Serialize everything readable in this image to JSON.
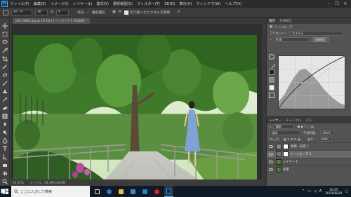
{
  "app": {
    "logo": "Ps"
  },
  "menu": [
    "ファイル(F)",
    "編集(E)",
    "イメージ(I)",
    "レイヤー(L)",
    "書式(Y)",
    "選択範囲(S)",
    "フィルター(T)",
    "3D(D)",
    "表示(V)",
    "ウィンドウ(W)",
    "ヘルプ(H)"
  ],
  "window_controls": {
    "minimize": "–",
    "restore": "❐",
    "close": "✕"
  },
  "options": {
    "size_field": "16 : 9",
    "width_value": "16",
    "height_value": "9",
    "clear_label": "消去",
    "straighten_label": "角度補正",
    "delete_cropped_label": "切り抜いたピクセルを削除"
  },
  "document": {
    "tab_title": "DSC_9081.jpg @ 19.5% (トーンカーブ 1, RGB/8) *",
    "status": "19.55%　　ファイル : 34.3M/148.0M"
  },
  "properties": {
    "tabs": [
      "属性",
      "色調補正"
    ],
    "panel_title": "トーンカーブ",
    "preset_label": "プリセット：",
    "preset_value": "カスタム",
    "channel_value": "RGB",
    "auto_button": "自動補正"
  },
  "layers_panel": {
    "tabs": [
      "レイヤー",
      "チャンネル",
      "パス"
    ],
    "filter_value": "種類",
    "blend_mode": "通常",
    "opacity_label": "不透明度：",
    "opacity_value": "100%",
    "lock_label": "ロック：",
    "fill_label": "塗り：",
    "fill_value": "100%",
    "items": [
      {
        "name": "色相・彩度 1"
      },
      {
        "name": "トーンカーブ 1"
      },
      {
        "name": "レイヤー 1"
      },
      {
        "name": "背景"
      }
    ]
  },
  "taskbar": {
    "search_placeholder": "ここに入力して検索",
    "time": "10:25",
    "date": "2019/06/29"
  },
  "colors": {
    "accent": "#31a8ff",
    "foreground": "#f6f6f6",
    "background": "#111111"
  }
}
